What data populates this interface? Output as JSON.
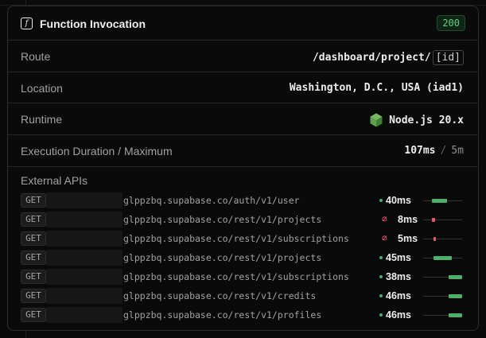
{
  "header": {
    "title": "Function Invocation",
    "status_code": "200"
  },
  "rows": {
    "route": {
      "label": "Route",
      "path": "/dashboard/project/",
      "param": "[id]"
    },
    "location": {
      "label": "Location",
      "value": "Washington, D.C., USA (iad1)"
    },
    "runtime": {
      "label": "Runtime",
      "value": "Node.js 20.x",
      "icon": "nodejs-icon"
    },
    "duration": {
      "label": "Execution Duration / Maximum",
      "value": "107ms",
      "separator": "/",
      "max": "5m"
    }
  },
  "external_apis": {
    "title": "External APIs",
    "calls": [
      {
        "method": "GET",
        "url": "glppzbq.supabase.co/auth/v1/user",
        "duration": "40ms",
        "status": "ok",
        "timeline_start": 0.22,
        "timeline_end": 0.62
      },
      {
        "method": "GET",
        "url": "glppzbq.supabase.co/rest/v1/projects",
        "duration": "8ms",
        "status": "error",
        "timeline_start": 0.22,
        "timeline_end": 0.3
      },
      {
        "method": "GET",
        "url": "glppzbq.supabase.co/rest/v1/subscriptions",
        "duration": "5ms",
        "status": "error",
        "timeline_start": 0.26,
        "timeline_end": 0.32
      },
      {
        "method": "GET",
        "url": "glppzbq.supabase.co/rest/v1/projects",
        "duration": "45ms",
        "status": "ok",
        "timeline_start": 0.26,
        "timeline_end": 0.74
      },
      {
        "method": "GET",
        "url": "glppzbq.supabase.co/rest/v1/subscriptions",
        "duration": "38ms",
        "status": "ok",
        "timeline_start": 0.66,
        "timeline_end": 1.0
      },
      {
        "method": "GET",
        "url": "glppzbq.supabase.co/rest/v1/credits",
        "duration": "46ms",
        "status": "ok",
        "timeline_start": 0.66,
        "timeline_end": 1.0
      },
      {
        "method": "GET",
        "url": "glppzbq.supabase.co/rest/v1/profiles",
        "duration": "46ms",
        "status": "ok",
        "timeline_start": 0.66,
        "timeline_end": 1.0
      }
    ]
  },
  "colors": {
    "ok": "#4caf6a",
    "error": "#e85a6b",
    "badge_green": "#5dd47a"
  }
}
